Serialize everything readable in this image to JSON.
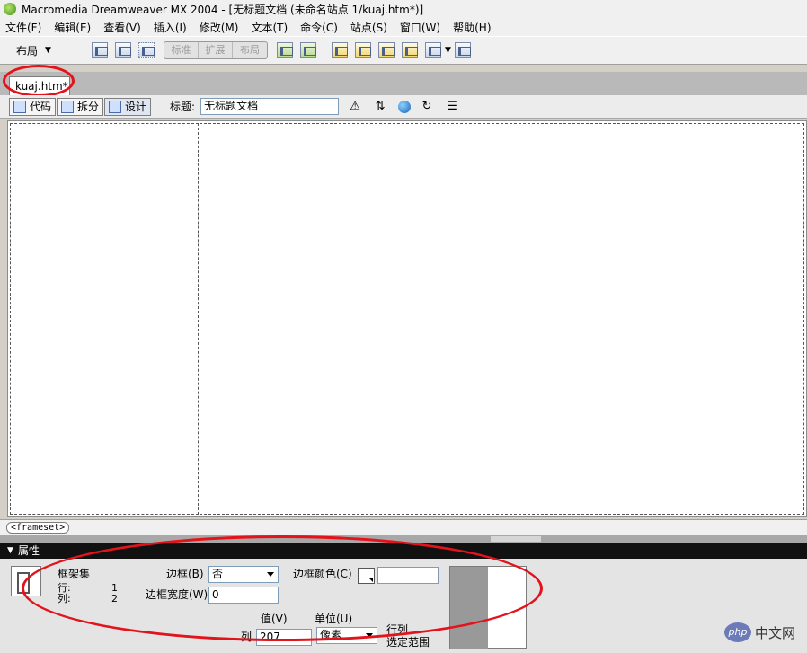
{
  "window": {
    "title": "Macromedia Dreamweaver MX 2004 - [无标题文档 (未命名站点 1/kuaj.htm*)]"
  },
  "menu": [
    "文件(F)",
    "编辑(E)",
    "查看(V)",
    "插入(I)",
    "修改(M)",
    "文本(T)",
    "命令(C)",
    "站点(S)",
    "窗口(W)",
    "帮助(H)"
  ],
  "insert_bar": {
    "category": "布局",
    "modes": [
      "标准",
      "扩展",
      "布局"
    ]
  },
  "document": {
    "tab": "kuaj.htm*",
    "views": [
      "代码",
      "拆分",
      "设计"
    ],
    "active_view": "设计",
    "title_label": "标题:",
    "title_value": "无标题文档"
  },
  "tag_selector": "<frameset>",
  "properties": {
    "header": "属性",
    "element_type": "框架集",
    "rows_label": "行:",
    "rows_value": "1",
    "cols_label": "列:",
    "cols_value": "2",
    "border_label": "边框(B)",
    "border_value": "否",
    "border_color_label": "边框颜色(C)",
    "border_color_value": "",
    "border_width_label": "边框宽度(W)",
    "border_width_value": "0",
    "value_label": "值(V)",
    "unit_label": "单位(U)",
    "column_label": "列",
    "column_value": "207",
    "unit_value": "像素",
    "rowcol_label": "行列",
    "select_range_label": "选定范围"
  },
  "watermark": {
    "logo": "php",
    "text": "中文网"
  }
}
